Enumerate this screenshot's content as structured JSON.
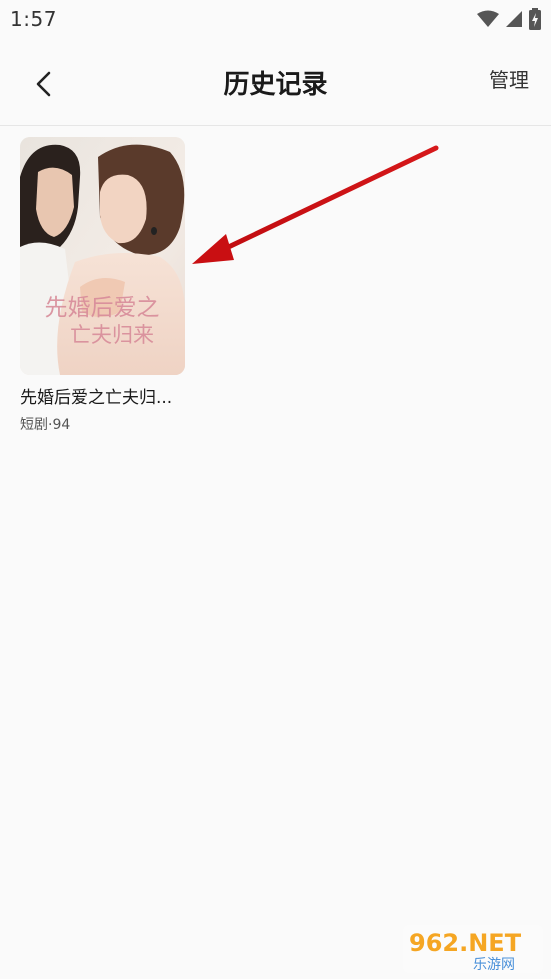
{
  "status": {
    "time": "1:57"
  },
  "header": {
    "title": "历史记录",
    "manage_label": "管理"
  },
  "history": {
    "items": [
      {
        "title": "先婚后爱之亡夫归...",
        "meta": "短剧·94",
        "cover_text_line1": "先婚后爱之",
        "cover_text_line2": "亡夫归来"
      }
    ]
  },
  "watermark": {
    "brand": "962.NET",
    "sub": "乐游网"
  },
  "colors": {
    "background": "#fafafa",
    "arrow": "#d6181a"
  }
}
